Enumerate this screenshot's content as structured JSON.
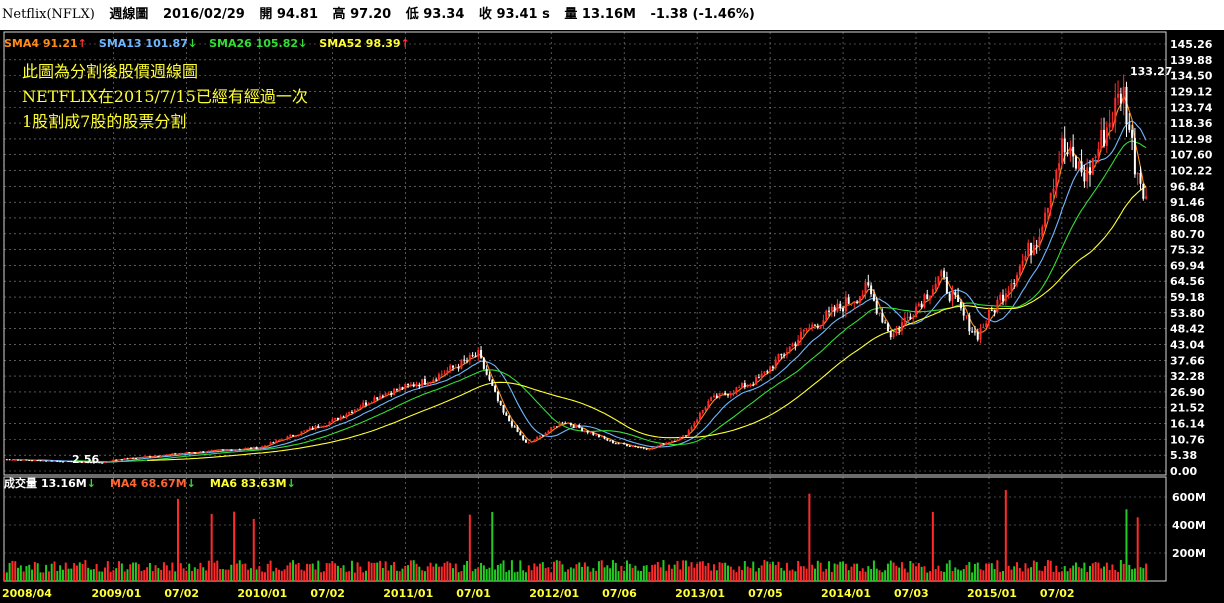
{
  "header": {
    "symbol": "Netflix(NFLX)",
    "period": "週線圖",
    "date": "2016/02/29",
    "open": "開 94.81",
    "high": "高 97.20",
    "low": "低 93.34",
    "close": "收 93.41 s",
    "volume": "量 13.16M",
    "change": "-1.38 (-1.46%)"
  },
  "sma_legend": [
    {
      "text": "SMA4 91.21",
      "arrow": "↑",
      "color": "#ff8c1a",
      "arrow_color": "#ff3333"
    },
    {
      "text": "SMA13 101.87",
      "arrow": "↓",
      "color": "#6fb7ff",
      "arrow_color": "#33dd33"
    },
    {
      "text": "SMA26 105.82",
      "arrow": "↓",
      "color": "#33dd33",
      "arrow_color": "#33dd33"
    },
    {
      "text": "SMA52 98.39",
      "arrow": "↑",
      "color": "#ffff33",
      "arrow_color": "#ff3333"
    }
  ],
  "annotation": {
    "lines": [
      "此圖為分割後股價週線圖",
      "NETFLIX在2015/7/15已經有經過一次",
      "1股割成7股的股票分割"
    ],
    "color": "#ffff33"
  },
  "volume_legend": [
    {
      "text": "成交量",
      "color": "#ffffff"
    },
    {
      "text": "13.16M",
      "color": "#ffffff",
      "arrow": "↓",
      "arrow_color": "#33dd33"
    },
    {
      "text": "MA4 68.67M",
      "color": "#ff6633",
      "arrow": "↓",
      "arrow_color": "#33dd33"
    },
    {
      "text": "MA6 83.63M",
      "color": "#ffff33",
      "arrow": "↓",
      "arrow_color": "#33dd33"
    }
  ],
  "colors": {
    "up": "#ff2a2a",
    "down": "#ffffff",
    "vol_up": "#ff2a2a",
    "vol_down": "#22cc22",
    "sma4": "#ff8c1a",
    "sma13": "#6fb7ff",
    "sma26": "#33dd33",
    "sma52": "#ffff33",
    "grid": "#c8c8c8",
    "frame": "#d7d7d7"
  },
  "chart_data": [
    {
      "type": "candlestick",
      "title": "週線圖",
      "price_ticks": [
        "145.26",
        "139.88",
        "134.50",
        "129.12",
        "123.74",
        "118.36",
        "112.98",
        "107.60",
        "102.22",
        "96.84",
        "91.46",
        "86.08",
        "80.70",
        "75.32",
        "69.94",
        "64.56",
        "59.18",
        "53.80",
        "48.42",
        "43.04",
        "37.66",
        "32.28",
        "26.90",
        "21.52",
        "16.14",
        "10.76",
        "5.38",
        "0.00"
      ],
      "ylim": [
        0,
        145.26
      ],
      "annotations": [
        {
          "label": "133.27",
          "kind": "high"
        },
        {
          "label": "2.56",
          "kind": "low"
        }
      ],
      "x_labels": [
        "2008/04",
        "2009/01",
        "07/02",
        "2010/01",
        "07/02",
        "2011/01",
        "07/01",
        "2012/01",
        "07/06",
        "2013/01",
        "07/05",
        "2014/01",
        "07/03",
        "2015/01",
        "07/02"
      ],
      "anchors": [
        {
          "date": "2008/04",
          "close": 4.0
        },
        {
          "date": "2008/12",
          "close": 2.8
        },
        {
          "date": "2009/01",
          "close": 3.8
        },
        {
          "date": "2009/07",
          "close": 6.2
        },
        {
          "date": "2010/01",
          "close": 8.0
        },
        {
          "date": "2010/07",
          "close": 17.0
        },
        {
          "date": "2010/11",
          "close": 26.0
        },
        {
          "date": "2011/03",
          "close": 31.0
        },
        {
          "date": "2011/07",
          "close": 39.5
        },
        {
          "date": "2011/09",
          "close": 20.0
        },
        {
          "date": "2011/11",
          "close": 9.0
        },
        {
          "date": "2012/02",
          "close": 17.0
        },
        {
          "date": "2012/06",
          "close": 9.8
        },
        {
          "date": "2012/09",
          "close": 7.5
        },
        {
          "date": "2012/12",
          "close": 12.0
        },
        {
          "date": "2013/02",
          "close": 24.0
        },
        {
          "date": "2013/06",
          "close": 31.0
        },
        {
          "date": "2013/10",
          "close": 48.0
        },
        {
          "date": "2014/03",
          "close": 62.0
        },
        {
          "date": "2014/05",
          "close": 46.0
        },
        {
          "date": "2014/09",
          "close": 66.0
        },
        {
          "date": "2014/11",
          "close": 52.0
        },
        {
          "date": "2014/12",
          "close": 46.0
        },
        {
          "date": "2015/03",
          "close": 66.0
        },
        {
          "date": "2015/05",
          "close": 80.0
        },
        {
          "date": "2015/07",
          "close": 110.0
        },
        {
          "date": "2015/09",
          "close": 100.0
        },
        {
          "date": "2015/12",
          "close": 130.0
        },
        {
          "date": "2016/01",
          "close": 105.0
        },
        {
          "date": "2016/02",
          "close": 93.41
        }
      ],
      "series": [
        {
          "name": "SMA4",
          "value": 91.21
        },
        {
          "name": "SMA13",
          "value": 101.87
        },
        {
          "name": "SMA26",
          "value": 105.82
        },
        {
          "name": "SMA52",
          "value": 98.39
        }
      ]
    },
    {
      "type": "bar",
      "title": "成交量",
      "volume_ticks": [
        "600M",
        "400M",
        "200M"
      ],
      "ylim": [
        0,
        700
      ],
      "last_volume": "13.16M",
      "series": [
        {
          "name": "MA4",
          "value": "68.67M"
        },
        {
          "name": "MA6",
          "value": "83.63M"
        }
      ]
    }
  ]
}
